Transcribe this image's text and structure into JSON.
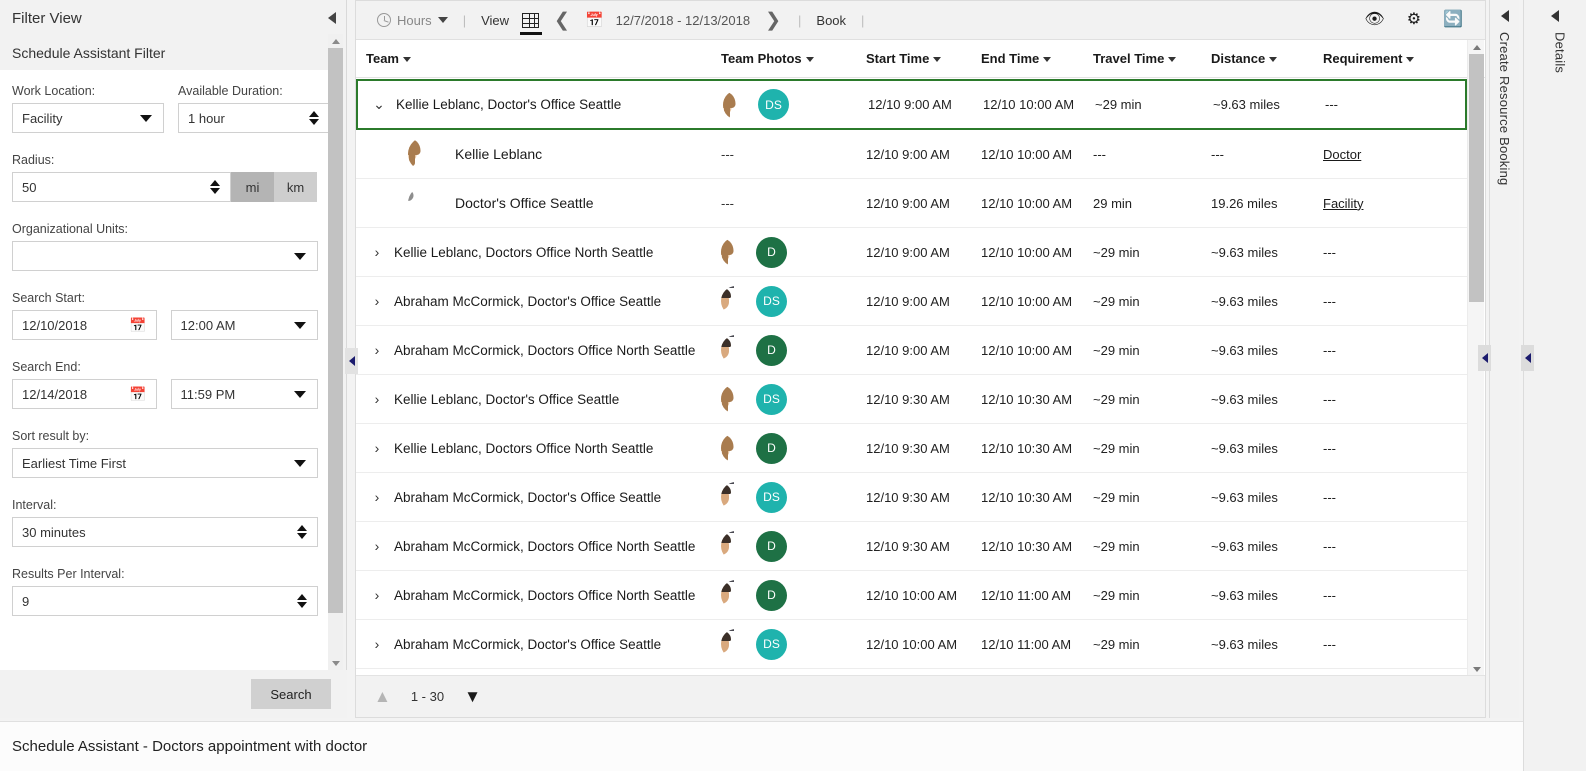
{
  "filter_panel": {
    "title": "Filter View",
    "subtitle": "Schedule Assistant Filter",
    "fields": {
      "work_location_label": "Work Location:",
      "work_location_value": "Facility",
      "available_duration_label": "Available Duration:",
      "available_duration_value": "1 hour",
      "radius_label": "Radius:",
      "radius_value": "50",
      "unit_mi": "mi",
      "unit_km": "km",
      "org_units_label": "Organizational Units:",
      "org_units_value": "",
      "search_start_label": "Search Start:",
      "search_start_date": "12/10/2018",
      "search_start_time": "12:00 AM",
      "search_end_label": "Search End:",
      "search_end_date": "12/14/2018",
      "search_end_time": "11:59 PM",
      "sort_label": "Sort result by:",
      "sort_value": "Earliest Time First",
      "interval_label": "Interval:",
      "interval_value": "30 minutes",
      "results_label": "Results Per Interval:",
      "results_value": "9"
    },
    "search_button": "Search"
  },
  "toolbar": {
    "hours_label": "Hours",
    "view_label": "View",
    "date_range": "12/7/2018 - 12/13/2018",
    "book_label": "Book",
    "separator": "|"
  },
  "table": {
    "columns": [
      {
        "label": "Team"
      },
      {
        "label": "Team Photos"
      },
      {
        "label": "Start Time"
      },
      {
        "label": "End Time"
      },
      {
        "label": "Travel Time"
      },
      {
        "label": "Distance"
      },
      {
        "label": "Requirement"
      }
    ],
    "rows": [
      {
        "team": "Kellie Leblanc, Doctor's Office Seattle",
        "expanded": true,
        "selected": true,
        "photo": "woman",
        "badge": "DS",
        "badge_color": "#1fb3ad",
        "start": "12/10 9:00 AM",
        "end": "12/10 10:00 AM",
        "travel": "~29 min",
        "distance": "~9.63 miles",
        "requirement": "---"
      },
      {
        "child": true,
        "name": "Kellie Leblanc",
        "photo": "woman",
        "photos_cell": "---",
        "start": "12/10 9:00 AM",
        "end": "12/10 10:00 AM",
        "travel": "---",
        "distance": "---",
        "requirement": "Doctor",
        "req_link": true
      },
      {
        "child": true,
        "name": "Doctor's Office Seattle",
        "photo": "generic",
        "photos_cell": "---",
        "start": "12/10 9:00 AM",
        "end": "12/10 10:00 AM",
        "travel": "29 min",
        "distance": "19.26 miles",
        "requirement": "Facility",
        "req_link": true
      },
      {
        "team": "Kellie Leblanc, Doctors Office North Seattle",
        "photo": "woman",
        "badge": "D",
        "badge_color": "#1e7145",
        "start": "12/10 9:00 AM",
        "end": "12/10 10:00 AM",
        "travel": "~29 min",
        "distance": "~9.63 miles",
        "requirement": "---"
      },
      {
        "team": "Abraham McCormick, Doctor's Office Seattle",
        "photo": "man",
        "badge": "DS",
        "badge_color": "#1fb3ad",
        "start": "12/10 9:00 AM",
        "end": "12/10 10:00 AM",
        "travel": "~29 min",
        "distance": "~9.63 miles",
        "requirement": "---"
      },
      {
        "team": "Abraham McCormick, Doctors Office North Seattle",
        "photo": "man",
        "badge": "D",
        "badge_color": "#1e7145",
        "start": "12/10 9:00 AM",
        "end": "12/10 10:00 AM",
        "travel": "~29 min",
        "distance": "~9.63 miles",
        "requirement": "---"
      },
      {
        "team": "Kellie Leblanc, Doctor's Office Seattle",
        "photo": "woman",
        "badge": "DS",
        "badge_color": "#1fb3ad",
        "start": "12/10 9:30 AM",
        "end": "12/10 10:30 AM",
        "travel": "~29 min",
        "distance": "~9.63 miles",
        "requirement": "---"
      },
      {
        "team": "Kellie Leblanc, Doctors Office North Seattle",
        "photo": "woman",
        "badge": "D",
        "badge_color": "#1e7145",
        "start": "12/10 9:30 AM",
        "end": "12/10 10:30 AM",
        "travel": "~29 min",
        "distance": "~9.63 miles",
        "requirement": "---"
      },
      {
        "team": "Abraham McCormick, Doctor's Office Seattle",
        "photo": "man",
        "badge": "DS",
        "badge_color": "#1fb3ad",
        "start": "12/10 9:30 AM",
        "end": "12/10 10:30 AM",
        "travel": "~29 min",
        "distance": "~9.63 miles",
        "requirement": "---"
      },
      {
        "team": "Abraham McCormick, Doctors Office North Seattle",
        "photo": "man",
        "badge": "D",
        "badge_color": "#1e7145",
        "start": "12/10 9:30 AM",
        "end": "12/10 10:30 AM",
        "travel": "~29 min",
        "distance": "~9.63 miles",
        "requirement": "---"
      },
      {
        "team": "Abraham McCormick, Doctors Office North Seattle",
        "photo": "man",
        "badge": "D",
        "badge_color": "#1e7145",
        "start": "12/10 10:00 AM",
        "end": "12/10 11:00 AM",
        "travel": "~29 min",
        "distance": "~9.63 miles",
        "requirement": "---"
      },
      {
        "team": "Abraham McCormick, Doctor's Office Seattle",
        "photo": "man",
        "badge": "DS",
        "badge_color": "#1fb3ad",
        "start": "12/10 10:00 AM",
        "end": "12/10 11:00 AM",
        "travel": "~29 min",
        "distance": "~9.63 miles",
        "requirement": "---"
      }
    ]
  },
  "pager": {
    "range": "1 - 30"
  },
  "right_panels": {
    "create_resource_booking": "Create Resource Booking",
    "details": "Details"
  },
  "statusbar": {
    "text": "Schedule Assistant - Doctors appointment with doctor"
  },
  "colors": {
    "selected_border": "#2b7a2b",
    "badge_teal": "#1fb3ad",
    "badge_green": "#1e7145"
  }
}
